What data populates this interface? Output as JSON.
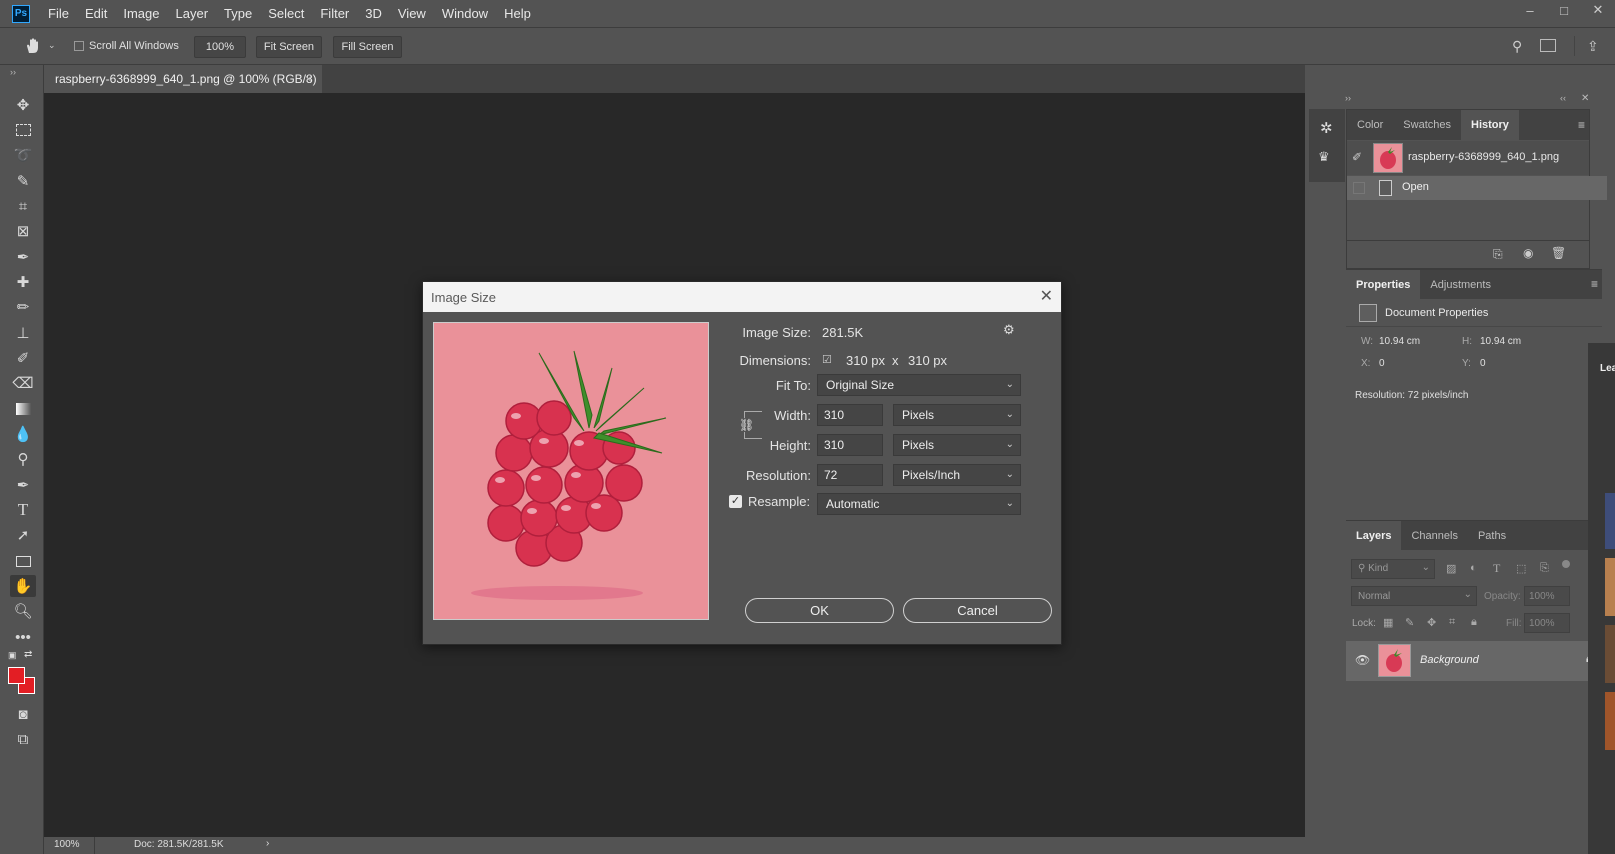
{
  "app": {
    "logo": "Ps"
  },
  "menu": [
    "File",
    "Edit",
    "Image",
    "Layer",
    "Type",
    "Select",
    "Filter",
    "3D",
    "View",
    "Window",
    "Help"
  ],
  "window_controls": {
    "minimize": "–",
    "maximize": "□",
    "close": "✕"
  },
  "options": {
    "scroll_all_windows": "Scroll All Windows",
    "zoom": "100%",
    "fit_screen": "Fit Screen",
    "fill_screen": "Fill Screen"
  },
  "document": {
    "tab_title": "raspberry-6368999_640_1.png @ 100% (RGB/8)",
    "close": "×"
  },
  "status": {
    "zoom": "100%",
    "doc": "Doc: 281.5K/281.5K"
  },
  "dialog": {
    "title": "Image Size",
    "image_size_label": "Image Size:",
    "image_size_value": "281.5K",
    "dimensions_label": "Dimensions:",
    "dim_w": "310 px",
    "dim_x": "x",
    "dim_h": "310 px",
    "fit_to_label": "Fit To:",
    "fit_to_value": "Original Size",
    "width_label": "Width:",
    "width_value": "310",
    "width_unit": "Pixels",
    "height_label": "Height:",
    "height_value": "310",
    "height_unit": "Pixels",
    "resolution_label": "Resolution:",
    "resolution_value": "72",
    "resolution_unit": "Pixels/Inch",
    "resample_label": "Resample:",
    "resample_value": "Automatic",
    "resample_checked": true,
    "ok": "OK",
    "cancel": "Cancel"
  },
  "history_panel": {
    "tabs": [
      "Color",
      "Swatches",
      "History"
    ],
    "active_tab": "History",
    "snapshot": "raspberry-6368999_640_1.png",
    "steps": [
      "Open"
    ]
  },
  "properties_panel": {
    "tabs": [
      "Properties",
      "Adjustments"
    ],
    "header": "Document Properties",
    "w_label": "W:",
    "w_value": "10.94 cm",
    "h_label": "H:",
    "h_value": "10.94 cm",
    "x_label": "X:",
    "x_value": "0",
    "y_label": "Y:",
    "y_value": "0",
    "resolution": "Resolution: 72 pixels/inch"
  },
  "layers_panel": {
    "tabs": [
      "Layers",
      "Channels",
      "Paths"
    ],
    "kind": "Kind",
    "blend": "Normal",
    "opacity_label": "Opacity:",
    "opacity_value": "100%",
    "lock_label": "Lock:",
    "fill_label": "Fill:",
    "fill_value": "100%",
    "layers": [
      {
        "name": "Background"
      }
    ]
  },
  "side_edge": {
    "label": "Lea"
  },
  "colors": {
    "foreground": "#e31e24",
    "background": "#e31e24",
    "canvas_bg": "#282828",
    "preview_bg": "#ea9199"
  }
}
